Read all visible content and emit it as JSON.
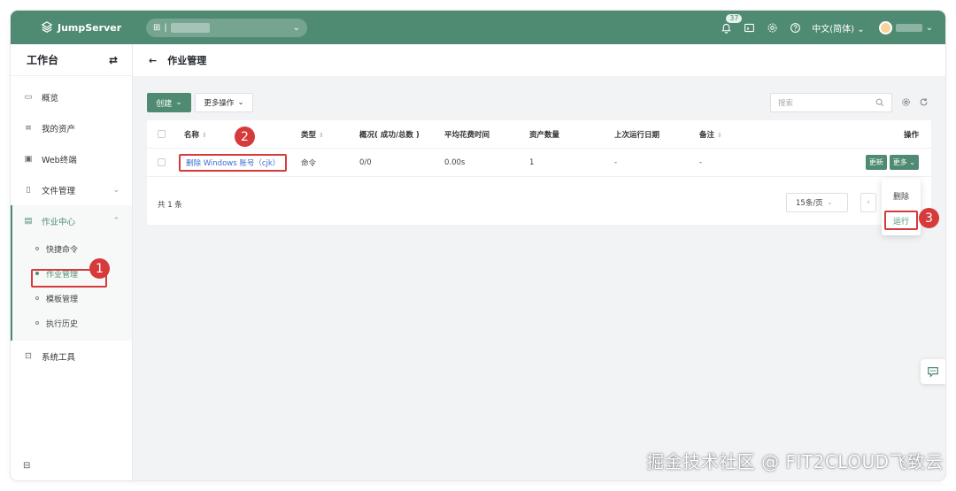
{
  "app": {
    "name": "JumpServer"
  },
  "topbar": {
    "org_prefix": "|",
    "notification_count": "37",
    "language": "中文(简体)"
  },
  "sidebar": {
    "title": "工作台",
    "items": [
      {
        "label": "概览"
      },
      {
        "label": "我的资产"
      },
      {
        "label": "Web终端"
      },
      {
        "label": "文件管理"
      },
      {
        "label": "作业中心"
      },
      {
        "label": "系统工具"
      }
    ],
    "submenu": [
      {
        "label": "快捷命令"
      },
      {
        "label": "作业管理"
      },
      {
        "label": "模板管理"
      },
      {
        "label": "执行历史"
      }
    ]
  },
  "page": {
    "title": "作业管理"
  },
  "toolbar": {
    "create_label": "创建",
    "more_ops_label": "更多操作",
    "search_placeholder": "搜索"
  },
  "table": {
    "columns": [
      "名称",
      "类型",
      "概况( 成功/总数 )",
      "平均花费时间",
      "资产数量",
      "上次运行日期",
      "备注",
      "操作"
    ],
    "rows": [
      {
        "name": "删除 Windows 账号（cjk）",
        "type": "命令",
        "summary": "0/0",
        "avg_time": "0.00s",
        "asset_count": "1",
        "last_run": "-",
        "comment": "-",
        "update_label": "更新",
        "more_label": "更多"
      }
    ],
    "total": "共 1 条",
    "page_size": "15条/页"
  },
  "dropdown": {
    "items": [
      "删除",
      "运行"
    ]
  },
  "annotations": [
    "1",
    "2",
    "3"
  ],
  "watermark": "掘金技术社区 @ FIT2CLOUD飞致云",
  "colors": {
    "brand": "#4f8b73",
    "annotation": "#d63a3a",
    "link": "#3b6fd0"
  }
}
